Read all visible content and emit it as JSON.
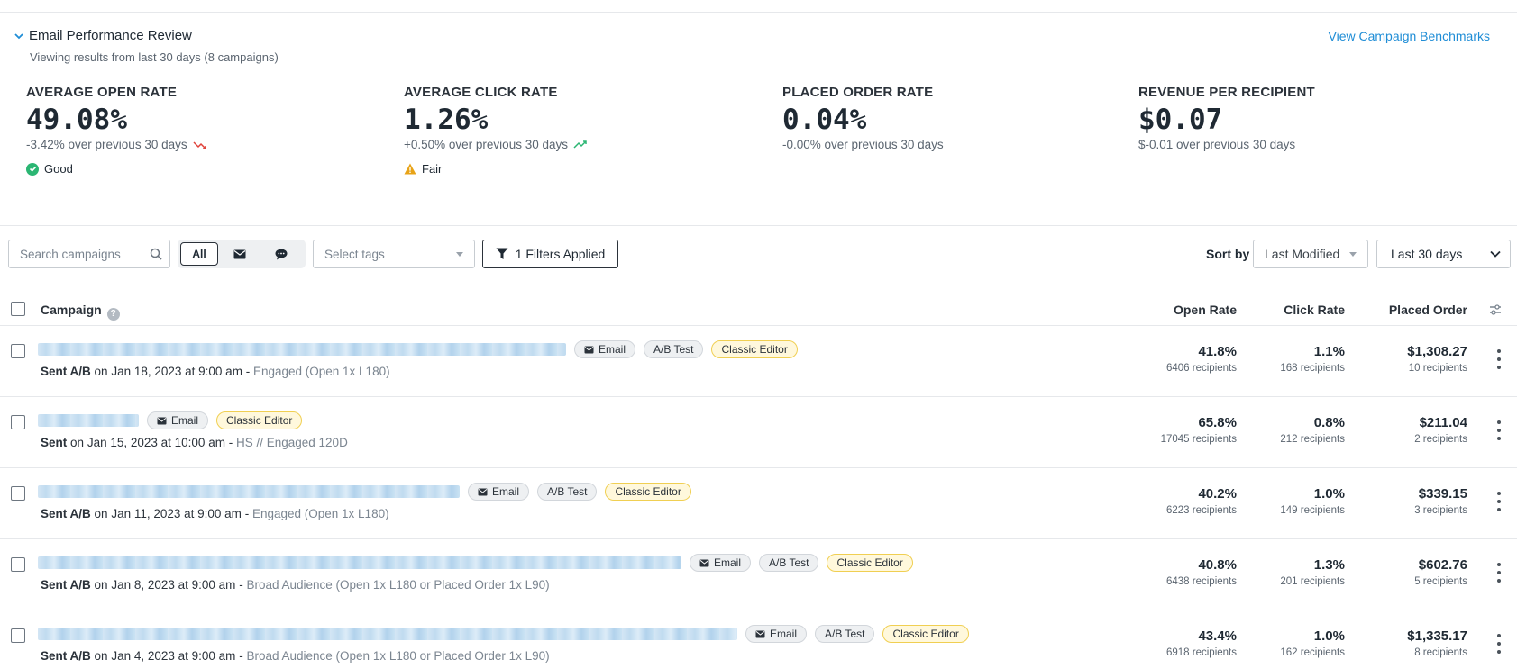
{
  "review": {
    "title": "Email Performance Review",
    "subtitle": "Viewing results from last 30 days (8 campaigns)",
    "benchmarks_link": "View Campaign Benchmarks"
  },
  "metrics": [
    {
      "label": "AVERAGE OPEN RATE",
      "value": "49.08%",
      "change": "-3.42% over previous 30 days",
      "trend": "down",
      "status": "Good"
    },
    {
      "label": "AVERAGE CLICK RATE",
      "value": "1.26%",
      "change": "+0.50% over previous 30 days",
      "trend": "up",
      "status": "Fair"
    },
    {
      "label": "PLACED ORDER RATE",
      "value": "0.04%",
      "change": "-0.00% over previous 30 days"
    },
    {
      "label": "REVENUE PER RECIPIENT",
      "value": "$0.07",
      "change": "$-0.01 over previous 30 days"
    }
  ],
  "colors": {
    "trend_down": "#e0423a",
    "trend_up": "#2bb673",
    "good": "#2bb673",
    "fair": "#e8a317",
    "link": "#1f8dd6",
    "classic_editor_border": "#f0cf52"
  },
  "toolbar": {
    "search_placeholder": "Search campaigns",
    "segments": {
      "all": "All",
      "email_icon": "envelope-icon",
      "sms_icon": "chat-bubble-icon"
    },
    "tags_placeholder": "Select tags",
    "filters_label": "1 Filters Applied",
    "sort_label": "Sort by",
    "sort_value": "Last Modified",
    "range_value": "Last 30 days"
  },
  "table": {
    "headers": {
      "campaign": "Campaign",
      "open_rate": "Open Rate",
      "click_rate": "Click Rate",
      "placed_order": "Placed Order"
    },
    "rows": [
      {
        "tags": [
          "Email",
          "A/B Test",
          "Classic Editor"
        ],
        "sent_type": "Sent A/B",
        "sent_on": "on",
        "date": "Jan 18, 2023 at 9:00 am",
        "sep": "-",
        "audience": "Engaged (Open 1x L180)",
        "open_rate": "41.8%",
        "open_recipients": "6406 recipients",
        "click_rate": "1.1%",
        "click_recipients": "168 recipients",
        "placed_order": "$1,308.27",
        "order_recipients": "10 recipients"
      },
      {
        "tags": [
          "Email",
          "Classic Editor"
        ],
        "sent_type": "Sent",
        "sent_on": "on",
        "date": "Jan 15, 2023 at 10:00 am",
        "sep": "-",
        "audience": "HS // Engaged 120D",
        "open_rate": "65.8%",
        "open_recipients": "17045 recipients",
        "click_rate": "0.8%",
        "click_recipients": "212 recipients",
        "placed_order": "$211.04",
        "order_recipients": "2 recipients"
      },
      {
        "tags": [
          "Email",
          "A/B Test",
          "Classic Editor"
        ],
        "sent_type": "Sent A/B",
        "sent_on": "on",
        "date": "Jan 11, 2023 at 9:00 am",
        "sep": "-",
        "audience": "Engaged (Open 1x L180)",
        "open_rate": "40.2%",
        "open_recipients": "6223 recipients",
        "click_rate": "1.0%",
        "click_recipients": "149 recipients",
        "placed_order": "$339.15",
        "order_recipients": "3 recipients"
      },
      {
        "tags": [
          "Email",
          "A/B Test",
          "Classic Editor"
        ],
        "sent_type": "Sent A/B",
        "sent_on": "on",
        "date": "Jan 8, 2023 at 9:00 am",
        "sep": "-",
        "audience": "Broad Audience (Open 1x L180 or Placed Order 1x L90)",
        "open_rate": "40.8%",
        "open_recipients": "6438 recipients",
        "click_rate": "1.3%",
        "click_recipients": "201 recipients",
        "placed_order": "$602.76",
        "order_recipients": "5 recipients"
      },
      {
        "tags": [
          "Email",
          "A/B Test",
          "Classic Editor"
        ],
        "sent_type": "Sent A/B",
        "sent_on": "on",
        "date": "Jan 4, 2023 at 9:00 am",
        "sep": "-",
        "audience": "Broad Audience (Open 1x L180 or Placed Order 1x L90)",
        "open_rate": "43.4%",
        "open_recipients": "6918 recipients",
        "click_rate": "1.0%",
        "click_recipients": "162 recipients",
        "placed_order": "$1,335.17",
        "order_recipients": "8 recipients"
      }
    ]
  }
}
